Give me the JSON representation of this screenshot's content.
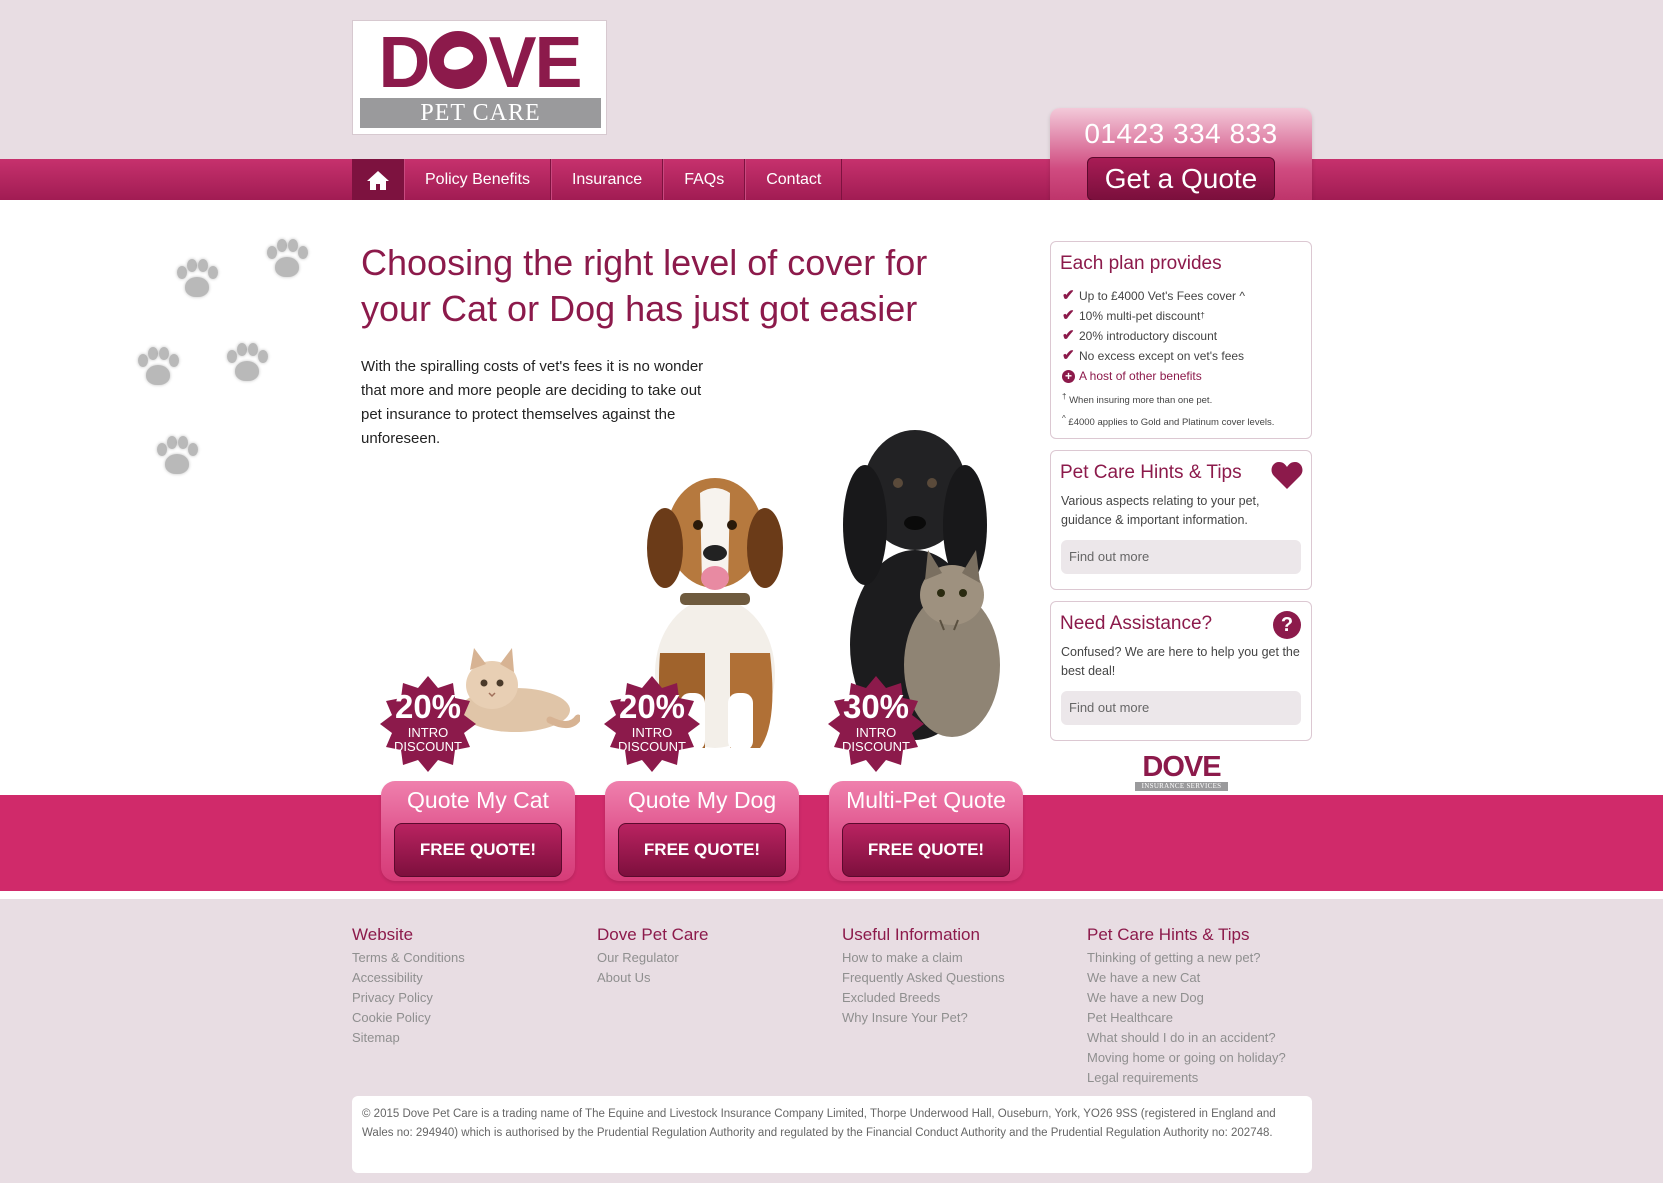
{
  "brand": {
    "logo_word": "DOVE",
    "logo_sub": "PET CARE",
    "insurance_logo_word": "DOVE",
    "insurance_logo_sub": "INSURANCE SERVICES",
    "primary_color": "#8c1a4b",
    "accent_color": "#d02a6a",
    "background_color": "#e8dde3"
  },
  "nav": {
    "home_icon": "home-icon",
    "items": [
      "Policy Benefits",
      "Insurance",
      "FAQs",
      "Contact"
    ]
  },
  "quote_box": {
    "phone": "01423 334 833",
    "button_label": "Get a Quote"
  },
  "main": {
    "headline": "Choosing the right level of cover for your Cat or Dog has just got easier",
    "intro": "With the spiralling costs of vet's fees it is no wonder that more and more people are deciding to take out pet insurance to protect themselves against the unforeseen."
  },
  "offers": [
    {
      "percent": "20%",
      "line1": "INTRO",
      "line2": "DISCOUNT",
      "title": "Quote My Cat",
      "button": "FREE QUOTE!"
    },
    {
      "percent": "20%",
      "line1": "INTRO",
      "line2": "DISCOUNT",
      "title": "Quote My Dog",
      "button": "FREE QUOTE!"
    },
    {
      "percent": "30%",
      "line1": "INTRO",
      "line2": "DISCOUNT",
      "title": "Multi-Pet Quote",
      "button": "FREE QUOTE!"
    }
  ],
  "plan_box": {
    "title": "Each plan provides",
    "items": [
      "Up to £4000 Vet's Fees cover ^",
      "10% multi-pet discount",
      "20% introductory discount",
      "No excess except on vet's fees"
    ],
    "dagger": "†",
    "more_link": "A host of other benefits",
    "note1": "When insuring more than one pet.",
    "note2": "£4000 applies to Gold and Platinum cover levels.",
    "note1_mark": "†",
    "note2_mark": "^"
  },
  "hints_box": {
    "title": "Pet Care Hints & Tips",
    "text": "Various aspects relating to your pet, guidance & important information.",
    "link": "Find out more"
  },
  "assist_box": {
    "title": "Need Assistance?",
    "icon_text": "?",
    "text": "Confused? We are here to help you get the best deal!",
    "link": "Find out more"
  },
  "footer": {
    "columns": [
      {
        "heading": "Website",
        "links": [
          "Terms & Conditions",
          "Accessibility",
          "Privacy Policy",
          "Cookie Policy",
          "Sitemap"
        ]
      },
      {
        "heading": "Dove Pet Care",
        "links": [
          "Our Regulator",
          "About Us"
        ]
      },
      {
        "heading": "Useful Information",
        "links": [
          "How to make a claim",
          "Frequently Asked Questions",
          "Excluded Breeds",
          "Why Insure Your Pet?"
        ]
      },
      {
        "heading": "Pet Care Hints & Tips",
        "links": [
          "Thinking of getting a new pet?",
          "We have a new Cat",
          "We have a new Dog",
          "Pet Healthcare",
          "What should I do in an accident?",
          "Moving home or going on holiday?",
          "Legal requirements"
        ]
      }
    ],
    "legal": "© 2015 Dove Pet Care is a trading name of The Equine and Livestock Insurance Company Limited, Thorpe Underwood Hall, Ouseburn, York, YO26 9SS (registered in England and Wales no: 294940) which is authorised by the Prudential Regulation Authority and regulated by the Financial Conduct Authority and the Prudential Regulation Authority no: 202748."
  }
}
